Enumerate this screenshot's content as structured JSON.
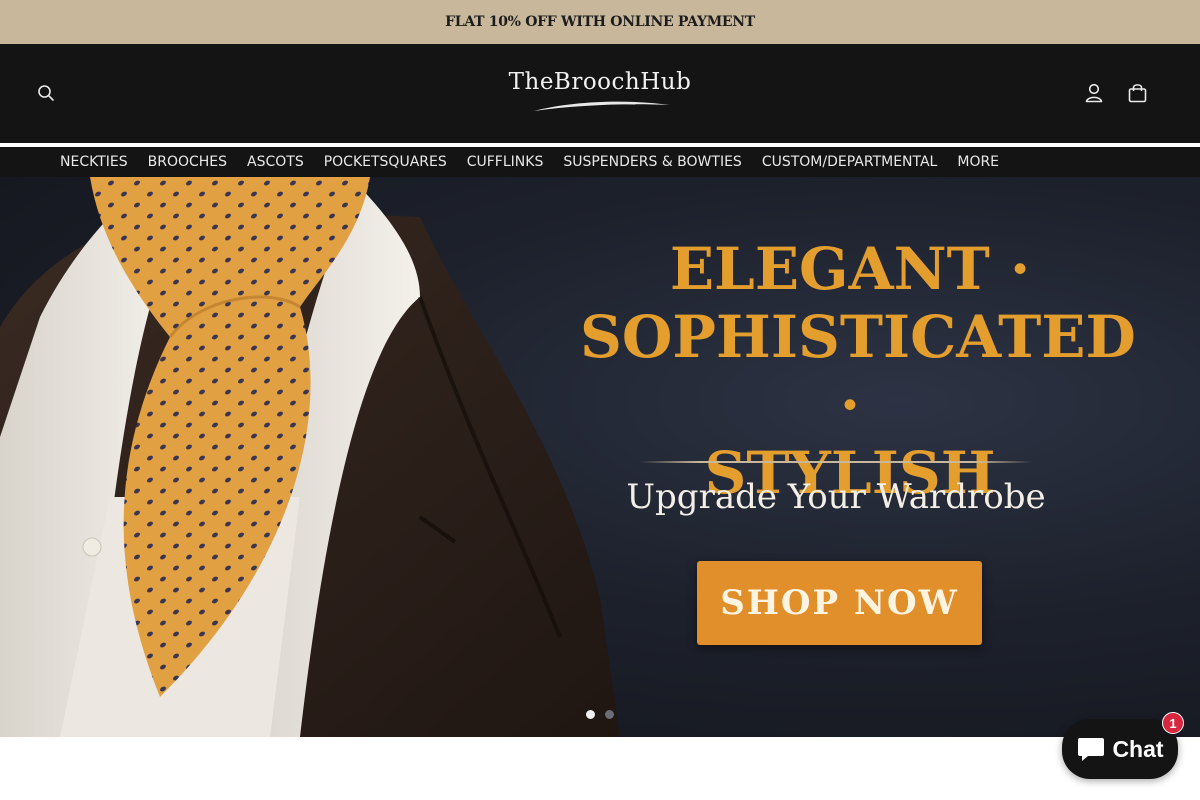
{
  "announcement": {
    "text": "FLAT 10% OFF WITH ONLINE PAYMENT"
  },
  "header": {
    "logo_text": "TheBroochHub",
    "icons": {
      "search": "search-icon",
      "account": "user-icon",
      "cart": "shopping-bag-icon"
    }
  },
  "nav": {
    "items": [
      {
        "label": "NECKTIES"
      },
      {
        "label": "BROOCHES"
      },
      {
        "label": "ASCOTS"
      },
      {
        "label": "POCKETSQUARES"
      },
      {
        "label": "CUFFLINKS"
      },
      {
        "label": "SUSPENDERS & BOWTIES"
      },
      {
        "label": "CUSTOM/DEPARTMENTAL"
      },
      {
        "label": "MORE"
      }
    ]
  },
  "hero": {
    "title_lines": [
      "ELEGANT ·",
      "SOPHISTICATED ·",
      "STYLISH"
    ],
    "subtitle": "Upgrade Your Wardrobe",
    "cta_label": "SHOP NOW",
    "slide_count": 2,
    "active_slide": 1
  },
  "chat": {
    "label": "Chat",
    "badge": "1"
  },
  "colors": {
    "announcement_bg": "#c9b79b",
    "header_bg": "#141414",
    "accent_gold": "#e49e2d",
    "cta_bg": "#e08f2b",
    "chat_badge": "#d7263d"
  }
}
